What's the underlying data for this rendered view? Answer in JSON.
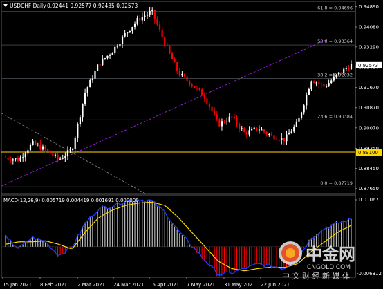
{
  "header": {
    "symbol": "USDCHF,Daily",
    "ohlc": "0.92441 0.92577 0.92435 0.92573"
  },
  "fib_levels": [
    {
      "label": "61.8 = 0.94696",
      "price": 0.94696
    },
    {
      "label": "50.0 = 0.93364",
      "price": 0.93364
    },
    {
      "label": "38.2 = 0.92032",
      "price": 0.92032
    },
    {
      "label": "23.6 = 0.90384",
      "price": 0.90384
    },
    {
      "label": "0.0 = 0.87719",
      "price": 0.87719
    }
  ],
  "price_axis": {
    "ticks": [
      "0.94890",
      "0.94080",
      "0.93290",
      "0.92490",
      "0.91670",
      "0.90870",
      "0.90070",
      "0.89250",
      "0.88450",
      "0.87650"
    ],
    "current_price": "0.92573",
    "hline_price": "0.89100"
  },
  "macd": {
    "label": "MACD(12,26,9) 0.005719 0.004419 0.001691 0.000000",
    "axis_top": "0.01067",
    "axis_bottom": "-0.006312"
  },
  "x_axis": {
    "labels": [
      "15 Jan 2021",
      "8 Feb 2021",
      "2 Mar 2021",
      "24 Mar 2021",
      "15 Apr 2021",
      "7 May 2021",
      "31 May 2021",
      "22 Jun 2021"
    ]
  },
  "watermark": {
    "brand": "中金网",
    "site": "CNGOLD.COM",
    "slogan": "中 文 财 经 新 媒 体"
  },
  "colors": {
    "background": "#000000",
    "bull": "#ffffff",
    "bear": "#ff0000",
    "fib": "#3a4044",
    "trendline": "#a020f0",
    "hline": "#ffd700",
    "macd_hist": "#c8c8c8",
    "signal": "#ffd700",
    "macd_line": "#1e3cff"
  },
  "chart_data": {
    "type": "candlestick",
    "symbol": "USDCHF",
    "timeframe": "Daily",
    "ohlc_last": {
      "open": 0.92441,
      "high": 0.92577,
      "low": 0.92435,
      "close": 0.92573
    },
    "waypoints": [
      [
        0.8888,
        0.002,
        0.0005
      ],
      [
        0.888,
        -0.0005,
        0.001
      ],
      [
        0.8945,
        0.002,
        0.001
      ],
      [
        0.892,
        0.001,
        0.0012
      ],
      [
        0.888,
        -0.002,
        0.0005
      ],
      [
        0.892,
        0.0,
        -0.0005
      ],
      [
        0.915,
        0.005,
        0.003
      ],
      [
        0.926,
        0.008,
        0.006
      ],
      [
        0.931,
        0.0085,
        0.0075
      ],
      [
        0.938,
        0.0095,
        0.0085
      ],
      [
        0.944,
        0.0098,
        0.009
      ],
      [
        0.947,
        0.0095,
        0.0092
      ],
      [
        0.934,
        0.007,
        0.0085
      ],
      [
        0.9225,
        0.003,
        0.006
      ],
      [
        0.918,
        0.0,
        0.003
      ],
      [
        0.913,
        -0.003,
        0.0
      ],
      [
        0.902,
        -0.006,
        -0.003
      ],
      [
        0.905,
        -0.0055,
        -0.0045
      ],
      [
        0.8985,
        -0.0045,
        -0.005
      ],
      [
        0.9005,
        -0.0035,
        -0.0045
      ],
      [
        0.8975,
        -0.004,
        -0.0042
      ],
      [
        0.896,
        -0.0045,
        -0.0043
      ],
      [
        0.903,
        -0.002,
        -0.0035
      ],
      [
        0.92,
        0.002,
        -0.001
      ],
      [
        0.917,
        0.004,
        0.001
      ],
      [
        0.922,
        0.005,
        0.003
      ],
      [
        0.9257,
        0.0057,
        0.0044
      ]
    ]
  }
}
